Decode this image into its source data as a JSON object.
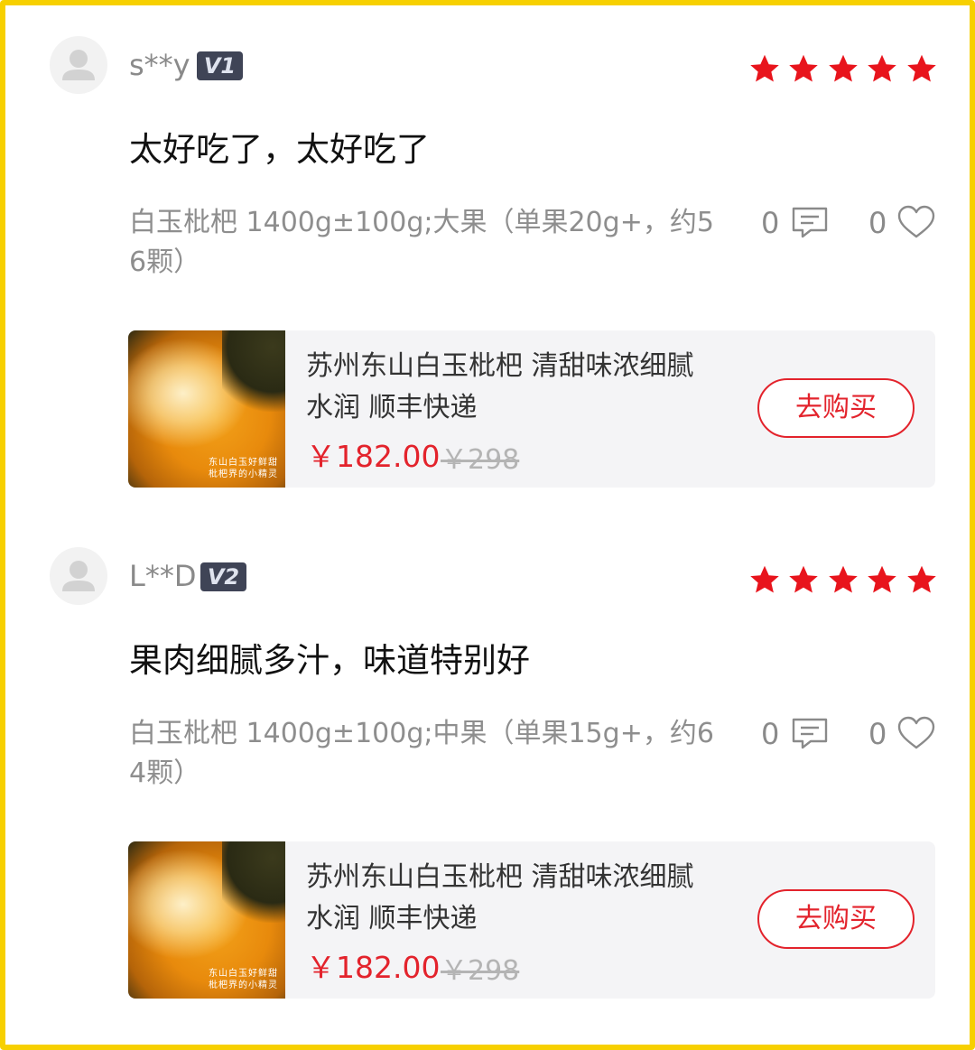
{
  "reviews": [
    {
      "username": "s**y",
      "level": "V1",
      "rating": 5,
      "text": "太好吃了，太好吃了",
      "spec": "白玉枇杷 1400g±100g;大果（单果20g+，约56颗）",
      "reply_count": "0",
      "like_count": "0",
      "product": {
        "thumb_text_1": "东山白玉好鲜甜",
        "thumb_text_2": "枇杷界的小精灵",
        "title": "苏州东山白玉枇杷 清甜味浓细腻水润 顺丰快递",
        "price": "￥182.00",
        "original_price": "￥298",
        "buy_label": "去购买"
      }
    },
    {
      "username": "L**D",
      "level": "V2",
      "rating": 5,
      "text": "果肉细腻多汁，味道特别好",
      "spec": "白玉枇杷 1400g±100g;中果（单果15g+，约64颗）",
      "reply_count": "0",
      "like_count": "0",
      "product": {
        "thumb_text_1": "东山白玉好鲜甜",
        "thumb_text_2": "枇杷界的小精灵",
        "title": "苏州东山白玉枇杷 清甜味浓细腻水润 顺丰快递",
        "price": "￥182.00",
        "original_price": "￥298",
        "buy_label": "去购买"
      }
    }
  ],
  "colors": {
    "accent": "#e3232c",
    "star": "#e8141c",
    "frame": "#f7d000",
    "badge": "#3f4456"
  },
  "icons": {
    "avatar": "user-silhouette-icon",
    "star": "star-icon",
    "reply": "comment-icon",
    "like": "heart-outline-icon"
  }
}
